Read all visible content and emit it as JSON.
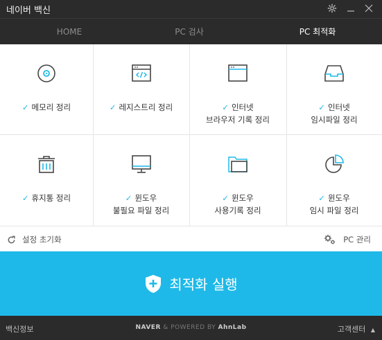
{
  "app": {
    "title": "네이버 백신"
  },
  "nav": {
    "tabs": [
      {
        "label": "HOME"
      },
      {
        "label": "PC 검사"
      },
      {
        "label": "PC 최적화"
      }
    ]
  },
  "grid": {
    "items": [
      {
        "line1": "메모리 정리",
        "line2": "",
        "icon": "memory-icon"
      },
      {
        "line1": "레지스트리 정리",
        "line2": "",
        "icon": "registry-icon"
      },
      {
        "line1": "인터넷",
        "line2": "브라우저 기록 정리",
        "icon": "browser-icon"
      },
      {
        "line1": "인터넷",
        "line2": "임시파일 정리",
        "icon": "inbox-icon"
      },
      {
        "line1": "휴지통 정리",
        "line2": "",
        "icon": "trash-icon"
      },
      {
        "line1": "윈도우",
        "line2": "불필요 파일 정리",
        "icon": "monitor-icon"
      },
      {
        "line1": "윈도우",
        "line2": "사용기록 정리",
        "icon": "folder-icon"
      },
      {
        "line1": "윈도우",
        "line2": "임시 파일 정리",
        "icon": "pie-chart-icon"
      }
    ]
  },
  "actions": {
    "reset": "설정 초기화",
    "pc_manage": "PC 관리"
  },
  "run": {
    "label": "최적화 실행"
  },
  "footer": {
    "info": "백신정보",
    "naver": "NAVER",
    "powered": "& POWERED BY",
    "ahnlab": "AhnLab",
    "support": "고객센터"
  },
  "colors": {
    "accent": "#1eb9e8",
    "dark": "#2b2b2b",
    "check": "#27b8e6"
  }
}
